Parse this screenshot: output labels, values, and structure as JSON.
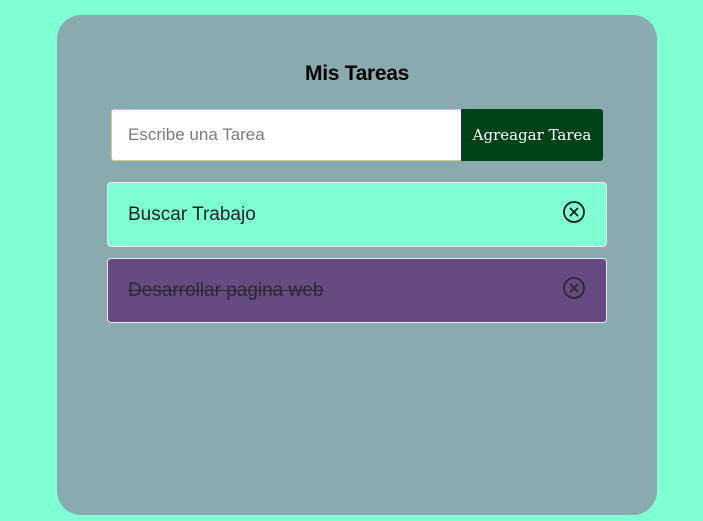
{
  "app": {
    "title": "Mis Tareas"
  },
  "form": {
    "input_placeholder": "Escribe una Tarea",
    "input_value": "",
    "add_button_label": "Agreagar Tarea"
  },
  "tasks": [
    {
      "text": "Buscar Trabajo",
      "completed": false,
      "delete_icon": "close-circle-icon"
    },
    {
      "text": "Desarrollar pagina web",
      "completed": true,
      "delete_icon": "close-circle-icon"
    }
  ],
  "colors": {
    "page_background": "#7fffd4",
    "card_background": "#89aaaf",
    "button_background": "#024219",
    "pending_task_background": "#7fffd4",
    "completed_task_background": "#664a82"
  }
}
